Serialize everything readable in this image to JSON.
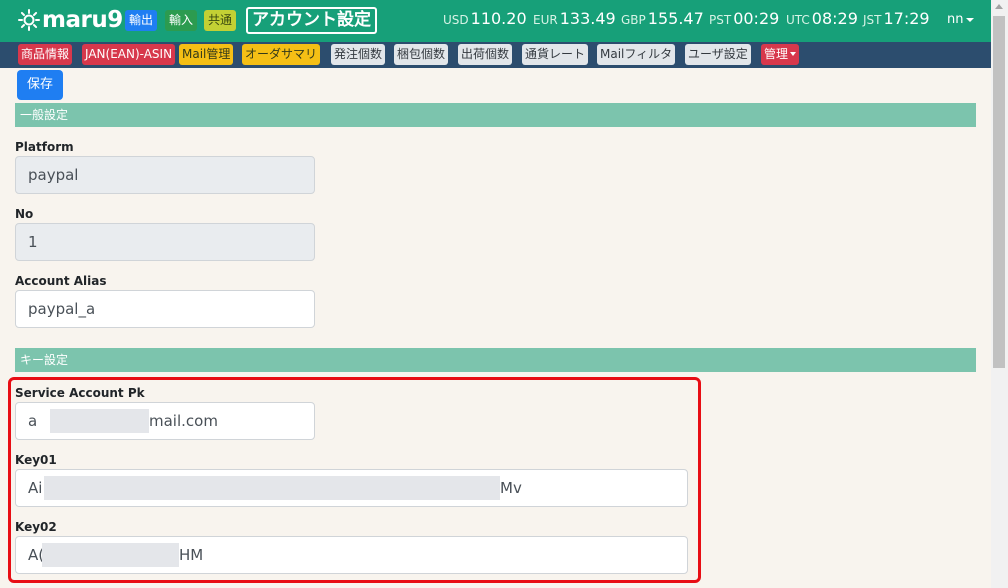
{
  "header": {
    "logo_text": "maru9",
    "badges": {
      "export": "輸出",
      "import": "輸入",
      "common": "共通"
    },
    "page_title": "アカウント設定",
    "rates": [
      {
        "label": "USD",
        "value": "110.20"
      },
      {
        "label": "EUR",
        "value": "133.49"
      },
      {
        "label": "GBP",
        "value": "155.47"
      },
      {
        "label": "PST",
        "value": "00:29"
      },
      {
        "label": "UTC",
        "value": "08:29"
      },
      {
        "label": "JST",
        "value": "17:29"
      }
    ],
    "user": "nn"
  },
  "nav": {
    "product_info": "商品情報",
    "jan_asin": "JAN(EAN)-ASIN",
    "mail_management": "Mail管理",
    "order_summary": "オーダサマリ",
    "order_count": "発注個数",
    "package_count": "梱包個数",
    "shipping_count": "出荷個数",
    "currency_rate": "通貨レート",
    "mail_filter": "Mailフィルタ",
    "user_settings": "ユーザ設定",
    "admin": "管理"
  },
  "actions": {
    "save": "保存"
  },
  "sections": {
    "general": "一般設定",
    "keys": "キー設定"
  },
  "fields": {
    "platform": {
      "label": "Platform",
      "value": "paypal"
    },
    "no": {
      "label": "No",
      "value": "1"
    },
    "account_alias": {
      "label": "Account Alias",
      "value": "paypal_a"
    },
    "service_account_pk": {
      "label": "Service Account Pk",
      "value_start": "a",
      "value_end": "mail.com"
    },
    "key01": {
      "label": "Key01",
      "value_start": "Ai",
      "value_end": "Mv"
    },
    "key02": {
      "label": "Key02",
      "value_start": "A(",
      "value_end": "HM"
    }
  },
  "colors": {
    "header": "#17a079",
    "nav": "#2c4d6e",
    "section": "#7cc4ad",
    "primary": "#1f7ef2",
    "highlight": "#e80d14"
  }
}
